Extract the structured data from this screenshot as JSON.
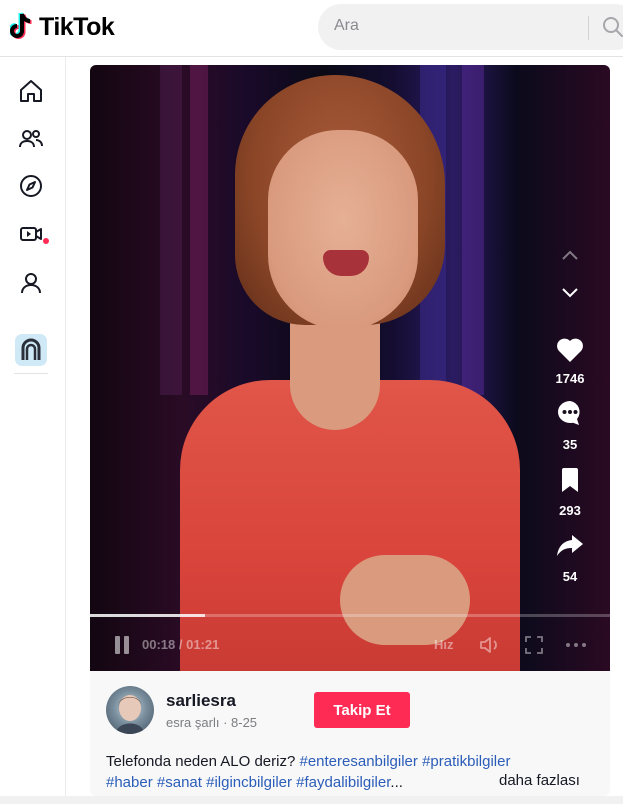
{
  "app": {
    "name": "TikTok"
  },
  "search": {
    "placeholder": "Ara"
  },
  "sidebar": {
    "items": [
      {
        "name": "home",
        "icon": "home-icon"
      },
      {
        "name": "following",
        "icon": "users-icon"
      },
      {
        "name": "explore",
        "icon": "compass-icon",
        "has_notification": true
      },
      {
        "name": "live",
        "icon": "video-camera-icon"
      },
      {
        "name": "profile",
        "icon": "user-icon"
      },
      {
        "name": "more",
        "icon": "app-icon"
      }
    ]
  },
  "video": {
    "likes": "1746",
    "comments": "35",
    "saves": "293",
    "shares": "54",
    "time": "00:18 / 01:21",
    "progress": 0.222,
    "speed_label": "Hız"
  },
  "post": {
    "username": "sarliesra",
    "nickname": "esra şarlı · 8-25",
    "follow_label": "Takip Et",
    "description_text": "Telefonda neden ALO deriz?",
    "hashtags_line1": [
      "#enteresanbilgiler",
      "#pratikbilgiler"
    ],
    "hashtags_line2": [
      "#haber",
      "#sanat",
      "#ilgincbilgiler",
      "#faydalibilgiler"
    ],
    "ellipsis": "...",
    "more_label": "daha fazlası"
  },
  "colors": {
    "accent": "#fe2c55",
    "hashtag": "#2b5db9"
  }
}
